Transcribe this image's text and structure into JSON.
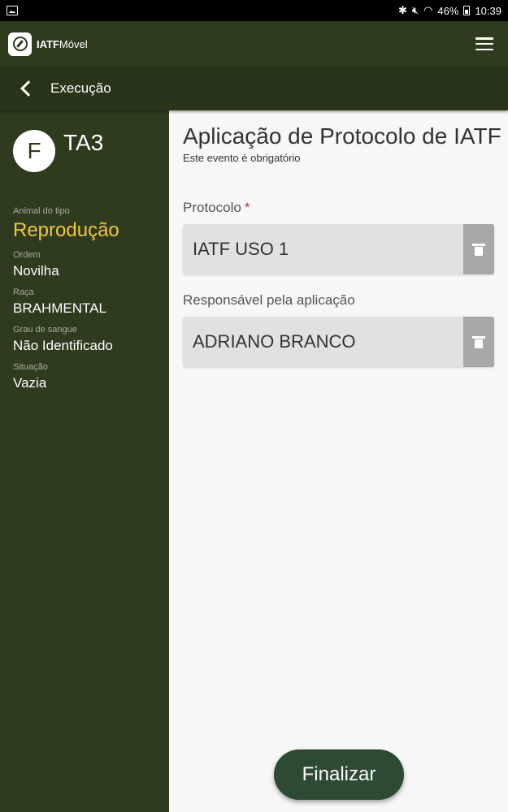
{
  "status_bar": {
    "battery": "46%",
    "time": "10:39",
    "icons": [
      "gallery-icon",
      "bluetooth-icon",
      "mute-icon",
      "wifi-icon",
      "battery-icon"
    ]
  },
  "app": {
    "logo_bold": "IATF",
    "logo_light": "Móvel"
  },
  "sub_header": {
    "title": "Execução"
  },
  "sidebar": {
    "avatar_letter": "F",
    "animal_id": "TA3",
    "fields": {
      "type_label": "Animal do tipo",
      "type_value": "Reprodução",
      "order_label": "Ordem",
      "order_value": "Novilha",
      "breed_label": "Raça",
      "breed_value": "BRAHMENTAL",
      "blood_label": "Grau de sangue",
      "blood_value": "Não Identificado",
      "situation_label": "Situação",
      "situation_value": "Vazia"
    }
  },
  "main": {
    "title": "Aplicação de Protocolo de IATF",
    "subtitle": "Este evento é obrigatório",
    "protocol_label": "Protocolo",
    "protocol_required": "*",
    "protocol_value": "IATF USO 1",
    "responsible_label": "Responsável pela aplicação",
    "responsible_value": "ADRIANO BRANCO"
  },
  "actions": {
    "finalize_label": "Finalizar"
  },
  "colors": {
    "header_bg": "#2e3b1f",
    "accent_yellow": "#f0c73a",
    "button_bg": "#2d4a33",
    "required_red": "#d0302b"
  }
}
